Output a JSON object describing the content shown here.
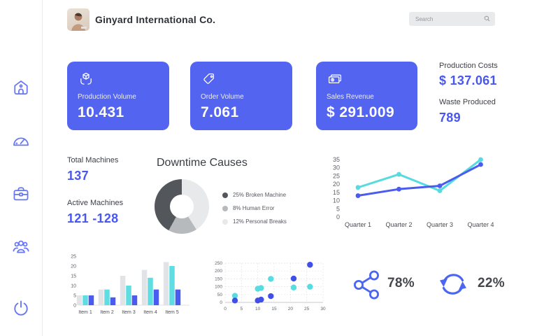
{
  "header": {
    "company": "Ginyard International Co.",
    "search_placeholder": "Search"
  },
  "sidebar": {
    "items": [
      {
        "name": "home",
        "icon": "home-icon"
      },
      {
        "name": "dashboard",
        "icon": "gauge-icon"
      },
      {
        "name": "machines",
        "icon": "briefcase-icon"
      },
      {
        "name": "team",
        "icon": "users-icon"
      },
      {
        "name": "logout",
        "icon": "power-icon"
      }
    ]
  },
  "kpi_cards": [
    {
      "icon": "box-in-hands-icon",
      "label": "Production Volume",
      "value": "10.431"
    },
    {
      "icon": "price-tag-icon",
      "label": "Order Volume",
      "value": "7.061"
    },
    {
      "icon": "cash-icon",
      "label": "Sales Revenue",
      "value": "$ 291.009"
    }
  ],
  "side_stats": [
    {
      "label": "Production Costs",
      "value": "$ 137.061"
    },
    {
      "label": "Waste Produced",
      "value": "789"
    }
  ],
  "machine_stats": [
    {
      "label": "Total Machines",
      "value": "137"
    },
    {
      "label": "Active Machines",
      "value": "121 -128"
    }
  ],
  "bottom_stats": [
    {
      "icon": "share-icon",
      "value": "78%"
    },
    {
      "icon": "refresh-icon",
      "value": "22%"
    }
  ],
  "colors": {
    "card_blue": "#5264f0",
    "value_blue": "#4857f0",
    "cyan": "#56dbe0",
    "line_blue": "#4a5cf0",
    "bar_gray": "#e2e3e6",
    "dark_slice": "#53565b",
    "mid_slice": "#b7babd",
    "light_slice": "#e8e9eb"
  },
  "chart_data": [
    {
      "id": "downtime-donut",
      "type": "pie",
      "title": "Downtime Causes",
      "legend": [
        {
          "label": "25% Broken Machine",
          "value": 25,
          "color": "#53565b"
        },
        {
          "label": "8% Human Error",
          "value": 8,
          "color": "#b7babd"
        },
        {
          "label": "12% Personal Breaks",
          "value": 12,
          "color": "#e8e9eb"
        }
      ],
      "display_segments": [
        {
          "color": "#e8e9eb",
          "pct": 41
        },
        {
          "color": "#b7babd",
          "pct": 17
        },
        {
          "color": "#53565b",
          "pct": 42
        }
      ],
      "donut_hole_ratio": 0.44
    },
    {
      "id": "quarterly-line",
      "type": "line",
      "categories": [
        "Quarter 1",
        "Quarter 2",
        "Quarter 3",
        "Quarter 4"
      ],
      "series": [
        {
          "name": "cyan",
          "color": "#56dbe0",
          "values": [
            18,
            26,
            16,
            35
          ]
        },
        {
          "name": "blue",
          "color": "#4a5cf0",
          "values": [
            13,
            17,
            19,
            32
          ]
        }
      ],
      "ylim": [
        0,
        35
      ],
      "yticks": [
        0,
        5,
        10,
        15,
        20,
        25,
        30,
        35
      ],
      "grid": false,
      "legend_position": "none"
    },
    {
      "id": "items-bar",
      "type": "bar",
      "categories": [
        "Item 1",
        "Item 2",
        "Item 3",
        "Item 4",
        "Item 5"
      ],
      "series": [
        {
          "name": "gray",
          "color": "#e2e3e6",
          "values": [
            5,
            8,
            15,
            18,
            22
          ]
        },
        {
          "name": "cyan",
          "color": "#5fdde2",
          "values": [
            5,
            8,
            10,
            14,
            20
          ]
        },
        {
          "name": "blue",
          "color": "#4a5cf0",
          "values": [
            5,
            4,
            5,
            8,
            8
          ]
        }
      ],
      "ylim": [
        0,
        25
      ],
      "yticks": [
        0,
        5,
        10,
        15,
        20,
        25
      ],
      "grid": false,
      "legend_position": "none"
    },
    {
      "id": "scatter",
      "type": "scatter",
      "xlim": [
        0,
        30
      ],
      "ylim": [
        0,
        250
      ],
      "xticks": [
        0,
        5,
        10,
        15,
        20,
        25,
        30
      ],
      "yticks": [
        0,
        50,
        100,
        150,
        200,
        250
      ],
      "grid": true,
      "series": [
        {
          "name": "cyan",
          "color": "#57dce1",
          "points": [
            [
              3,
              42
            ],
            [
              10,
              87
            ],
            [
              11,
              92
            ],
            [
              14,
              150
            ],
            [
              21,
              95
            ],
            [
              26,
              100
            ]
          ]
        },
        {
          "name": "blue",
          "color": "#3f4fe8",
          "points": [
            [
              3,
              12
            ],
            [
              10,
              12
            ],
            [
              11,
              18
            ],
            [
              14,
              40
            ],
            [
              21,
              152
            ],
            [
              26,
              240
            ]
          ]
        }
      ]
    }
  ]
}
